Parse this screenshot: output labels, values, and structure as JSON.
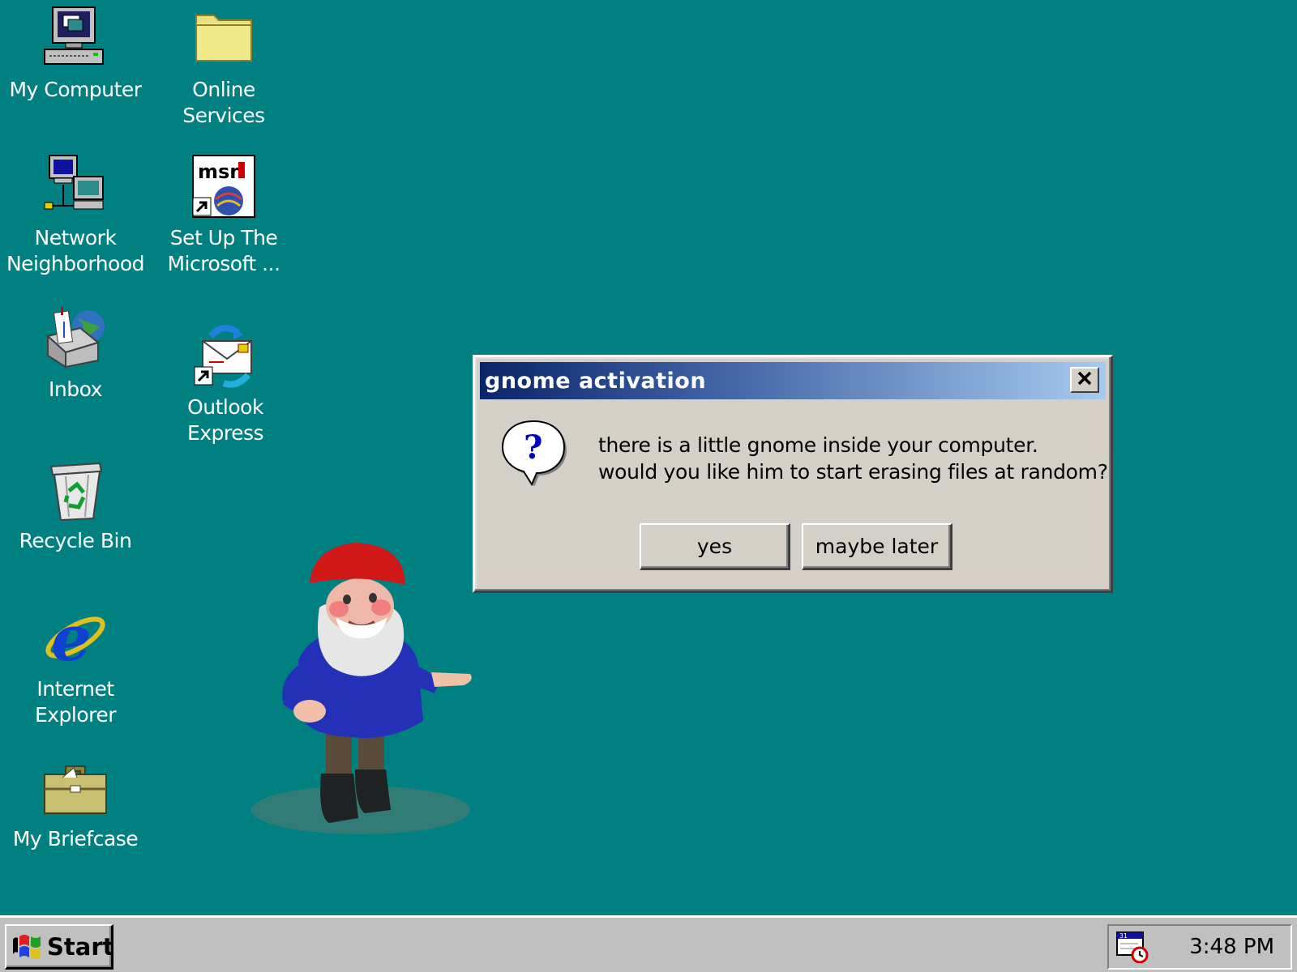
{
  "desktop": {
    "background": "#008080",
    "icons": [
      {
        "label": "My Computer",
        "icon": "my-computer-icon"
      },
      {
        "label": "Online\nServices",
        "icon": "folder-icon"
      },
      {
        "label": "Network\nNeighborhood",
        "icon": "network-neighborhood-icon"
      },
      {
        "label": "Set Up The\nMicrosoft ...",
        "icon": "msn-setup-icon"
      },
      {
        "label": "Inbox",
        "icon": "inbox-icon"
      },
      {
        "label": "Outlook\nExpress",
        "icon": "outlook-express-icon"
      },
      {
        "label": "Recycle Bin",
        "icon": "recycle-bin-icon"
      },
      {
        "label": "Internet\nExplorer",
        "icon": "internet-explorer-icon"
      },
      {
        "label": "My Briefcase",
        "icon": "briefcase-icon"
      }
    ]
  },
  "dialog": {
    "title": "gnome activation",
    "icon": "question-icon",
    "message_line1": "there is a little gnome inside your computer.",
    "message_line2": "would you like him to start erasing files at random?",
    "buttons": {
      "yes": "yes",
      "later": "maybe later"
    }
  },
  "taskbar": {
    "start_label": "Start",
    "tray_icon": "scheduler-tray-icon",
    "clock": "3:48 PM"
  }
}
